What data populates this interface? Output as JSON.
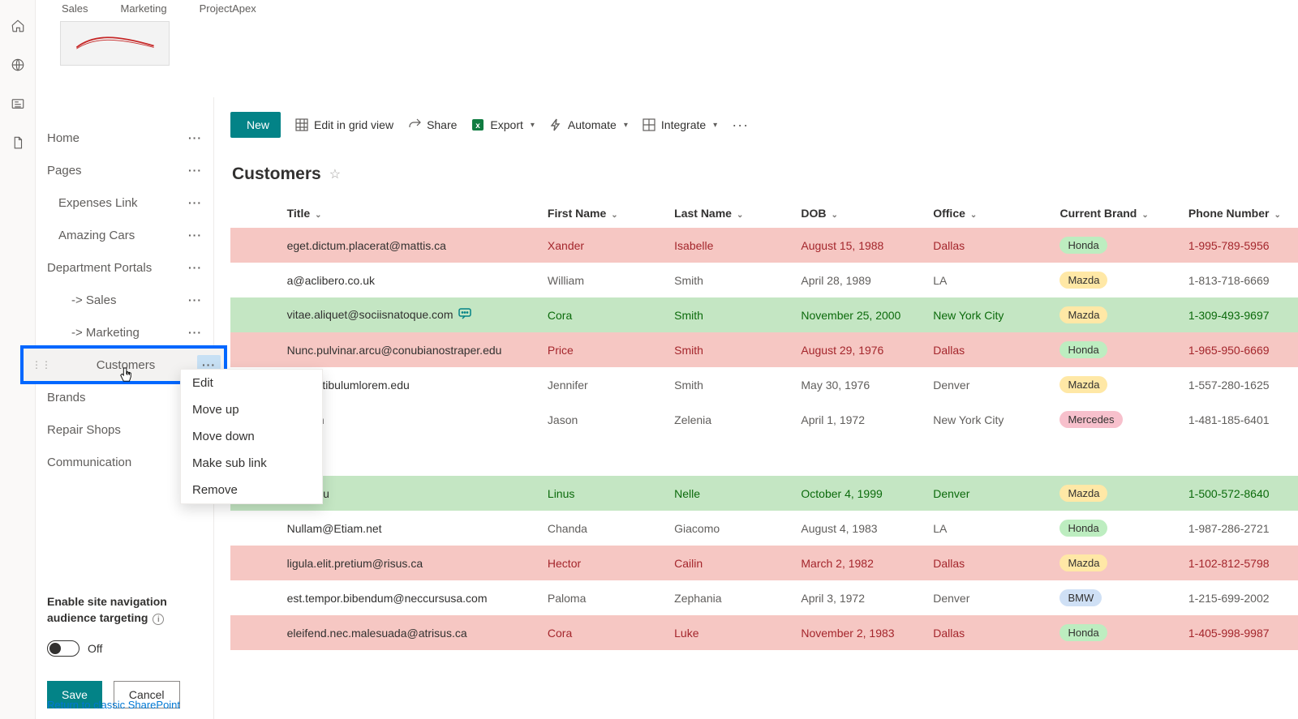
{
  "top_tabs": [
    "Sales",
    "Marketing",
    "ProjectApex"
  ],
  "nav": {
    "items": [
      {
        "label": "Home"
      },
      {
        "label": "Pages"
      },
      {
        "label": "Expenses Link"
      },
      {
        "label": "Amazing Cars"
      },
      {
        "label": "Department Portals"
      },
      {
        "label": "-> Sales"
      },
      {
        "label": "-> Marketing"
      },
      {
        "label": "Customers"
      },
      {
        "label": "Brands"
      },
      {
        "label": "Repair Shops"
      },
      {
        "label": "Communication"
      }
    ],
    "audience_title_l1": "Enable site navigation",
    "audience_title_l2": "audience targeting",
    "toggle_label": "Off",
    "save": "Save",
    "cancel": "Cancel",
    "classic_link": "Return to classic SharePoint"
  },
  "context_menu": [
    "Edit",
    "Move up",
    "Move down",
    "Make sub link",
    "Remove"
  ],
  "toolbar": {
    "new": "New",
    "edit_grid": "Edit in grid view",
    "share": "Share",
    "export": "Export",
    "automate": "Automate",
    "integrate": "Integrate"
  },
  "list": {
    "title": "Customers",
    "columns": [
      "Title",
      "First Name",
      "Last Name",
      "DOB",
      "Office",
      "Current Brand",
      "Phone Number"
    ],
    "rows": [
      {
        "style": "red",
        "title": "eget.dictum.placerat@mattis.ca",
        "first": "Xander",
        "last": "Isabelle",
        "dob": "August 15, 1988",
        "office": "Dallas",
        "brand": "Honda",
        "phone": "1-995-789-5956"
      },
      {
        "style": "plain",
        "title": "a@aclibero.co.uk",
        "first": "William",
        "last": "Smith",
        "dob": "April 28, 1989",
        "office": "LA",
        "brand": "Mazda",
        "phone": "1-813-718-6669"
      },
      {
        "style": "green",
        "title": "vitae.aliquet@sociisnatoque.com",
        "first": "Cora",
        "last": "Smith",
        "dob": "November 25, 2000",
        "office": "New York City",
        "brand": "Mazda",
        "phone": "1-309-493-9697",
        "comment": true
      },
      {
        "style": "red",
        "title": "Nunc.pulvinar.arcu@conubianostraper.edu",
        "first": "Price",
        "last": "Smith",
        "dob": "August 29, 1976",
        "office": "Dallas",
        "brand": "Honda",
        "phone": "1-965-950-6669"
      },
      {
        "style": "plain",
        "title": "e@vestibulumlorem.edu",
        "first": "Jennifer",
        "last": "Smith",
        "dob": "May 30, 1976",
        "office": "Denver",
        "brand": "Mazda",
        "phone": "1-557-280-1625"
      },
      {
        "style": "plain",
        "title": "on.com",
        "first": "Jason",
        "last": "Zelenia",
        "dob": "April 1, 1972",
        "office": "New York City",
        "brand": "Mercedes",
        "phone": "1-481-185-6401"
      },
      {
        "style": "gap"
      },
      {
        "style": "green",
        "title": "@in.edu",
        "first": "Linus",
        "last": "Nelle",
        "dob": "October 4, 1999",
        "office": "Denver",
        "brand": "Mazda",
        "phone": "1-500-572-8640"
      },
      {
        "style": "plain",
        "title": "Nullam@Etiam.net",
        "first": "Chanda",
        "last": "Giacomo",
        "dob": "August 4, 1983",
        "office": "LA",
        "brand": "Honda",
        "phone": "1-987-286-2721"
      },
      {
        "style": "red",
        "title": "ligula.elit.pretium@risus.ca",
        "first": "Hector",
        "last": "Cailin",
        "dob": "March 2, 1982",
        "office": "Dallas",
        "brand": "Mazda",
        "phone": "1-102-812-5798"
      },
      {
        "style": "plain",
        "title": "est.tempor.bibendum@neccursusa.com",
        "first": "Paloma",
        "last": "Zephania",
        "dob": "April 3, 1972",
        "office": "Denver",
        "brand": "BMW",
        "phone": "1-215-699-2002"
      },
      {
        "style": "red",
        "title": "eleifend.nec.malesuada@atrisus.ca",
        "first": "Cora",
        "last": "Luke",
        "dob": "November 2, 1983",
        "office": "Dallas",
        "brand": "Honda",
        "phone": "1-405-998-9987"
      }
    ]
  }
}
